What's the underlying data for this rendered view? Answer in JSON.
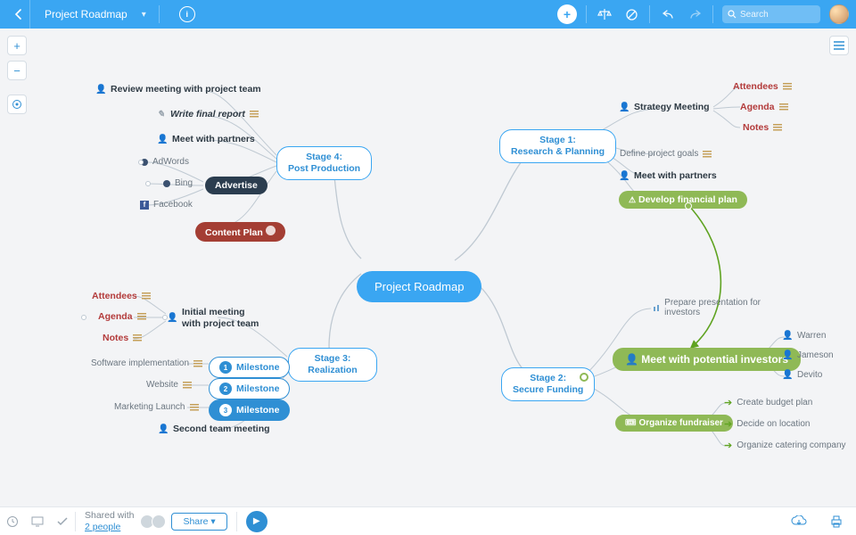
{
  "topbar": {
    "title": "Project Roadmap",
    "search_placeholder": "Search"
  },
  "central": "Project Roadmap",
  "stages": {
    "s1": {
      "title": "Stage 1:\nResearch & Planning"
    },
    "s2": {
      "title": "Stage 2:\nSecure Funding"
    },
    "s3": {
      "title": "Stage 3:\nRealization"
    },
    "s4": {
      "title": "Stage 4:\nPost Production"
    }
  },
  "s1": {
    "strategy": "Strategy Meeting",
    "attendees": "Attendees",
    "agenda": "Agenda",
    "notes": "Notes",
    "goals": "Define project goals",
    "partners": "Meet with partners",
    "finplan": "Develop financial plan"
  },
  "s2": {
    "prep": "Prepare presentation for investors",
    "meet": "Meet with potential investors",
    "warren": "Warren",
    "jameson": "Jameson",
    "devito": "Devito",
    "fund": "Organize fundraiser",
    "budget": "Create budget plan",
    "location": "Decide on location",
    "catering": "Organize catering company"
  },
  "s3": {
    "initial": "Initial meeting with project team",
    "attendees": "Attendees",
    "agenda": "Agenda",
    "notes": "Notes",
    "m1": "Milestone",
    "m2": "Milestone",
    "m3": "Milestone",
    "soft": "Software implementation",
    "web": "Website",
    "mkt": "Marketing Launch",
    "second": "Second team meeting"
  },
  "s4": {
    "review": "Review meeting with project team",
    "report": "Write final report",
    "partners": "Meet with partners",
    "adv": "Advertise",
    "adwords": "AdWords",
    "bing": "Bing",
    "fb": "Facebook",
    "content": "Content Plan"
  },
  "bottombar": {
    "shared_label": "Shared with",
    "people": "2 people",
    "share": "Share"
  }
}
